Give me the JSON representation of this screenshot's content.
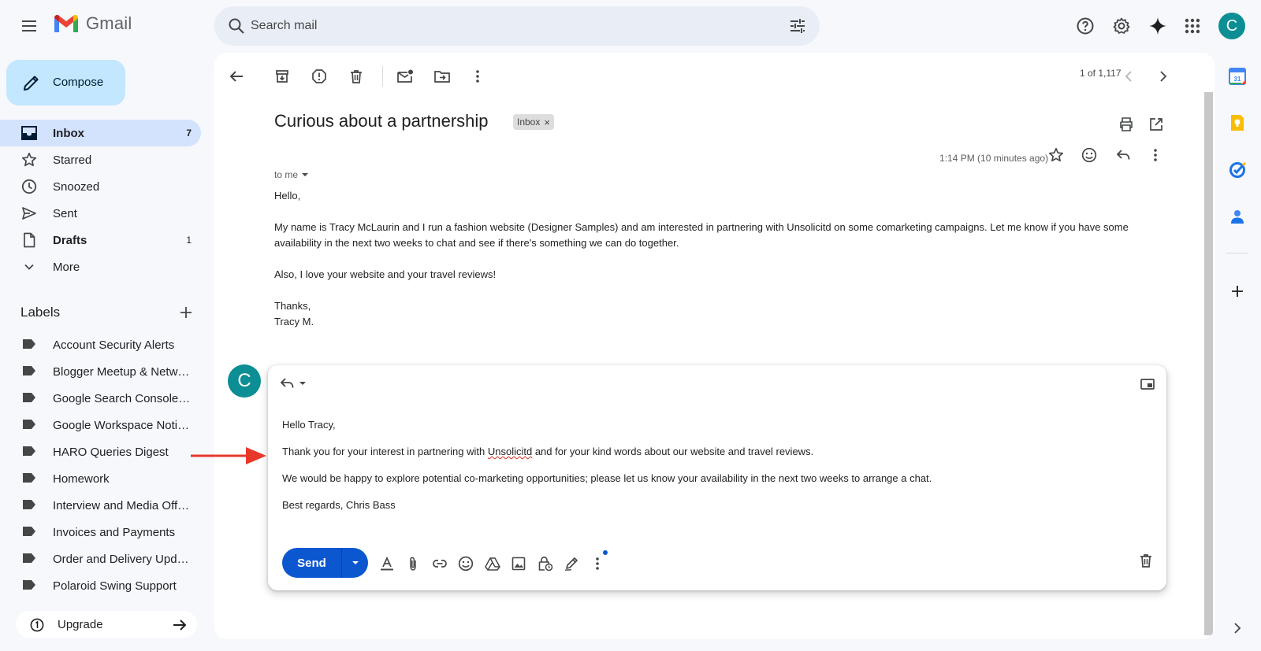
{
  "app": {
    "logo_text": "Gmail",
    "avatar_letter": "C"
  },
  "search": {
    "placeholder": "Search mail"
  },
  "compose": {
    "label": "Compose"
  },
  "nav": [
    {
      "label": "Inbox",
      "count": "7",
      "active": true,
      "icon": "inbox-icon"
    },
    {
      "label": "Starred",
      "count": "",
      "icon": "star-icon"
    },
    {
      "label": "Snoozed",
      "count": "",
      "icon": "clock-icon"
    },
    {
      "label": "Sent",
      "count": "",
      "icon": "send-icon"
    },
    {
      "label": "Drafts",
      "count": "1",
      "icon": "draft-icon"
    },
    {
      "label": "More",
      "count": "",
      "icon": "chevron-down-icon"
    }
  ],
  "labels_heading": "Labels",
  "labels": [
    "Account Security Alerts",
    "Blogger Meetup & Networking",
    "Google Search Console Updates",
    "Google Workspace Notifications",
    "HARO Queries Digest",
    "Homework",
    "Interview and Media Offers",
    "Invoices and Payments",
    "Order and Delivery Updates",
    "Polaroid Swing Support"
  ],
  "upgrade": {
    "label": "Upgrade"
  },
  "toolbar": {
    "pager": "1 of 1,117"
  },
  "email": {
    "subject": "Curious about a partnership",
    "chip": "Inbox",
    "time": "1:14 PM (10 minutes ago)",
    "to": "to me",
    "greeting": "Hello,",
    "para1": "My name is Tracy McLaurin and I run a fashion website (Designer Samples) and am interested in partnering with Unsolicitd on some comarketing campaigns. Let me know if you have some availability in the next two weeks to chat and see if there's something we can do together.",
    "para2": "Also, I love your website and your travel reviews!",
    "signoff1": "Thanks,",
    "signoff2": "Tracy M."
  },
  "reply": {
    "avatar_letter": "C",
    "line1": "Hello Tracy,",
    "line2_pre": "Thank you for your interest in partnering with ",
    "line2_word": "Unsolicitd",
    "line2_post": " and for your kind words about our website and travel reviews.",
    "line3": "We would be happy to explore potential co-marketing opportunities; please let us know your availability in the next two weeks to arrange a chat.",
    "line4": "Best regards, Chris Bass",
    "send_label": "Send"
  },
  "colors": {
    "accent": "#0b57d0",
    "compose_bg": "#c2e7ff",
    "active_nav": "#d3e3fd",
    "avatar": "#0b8e94",
    "annotation": "#e8382b"
  }
}
